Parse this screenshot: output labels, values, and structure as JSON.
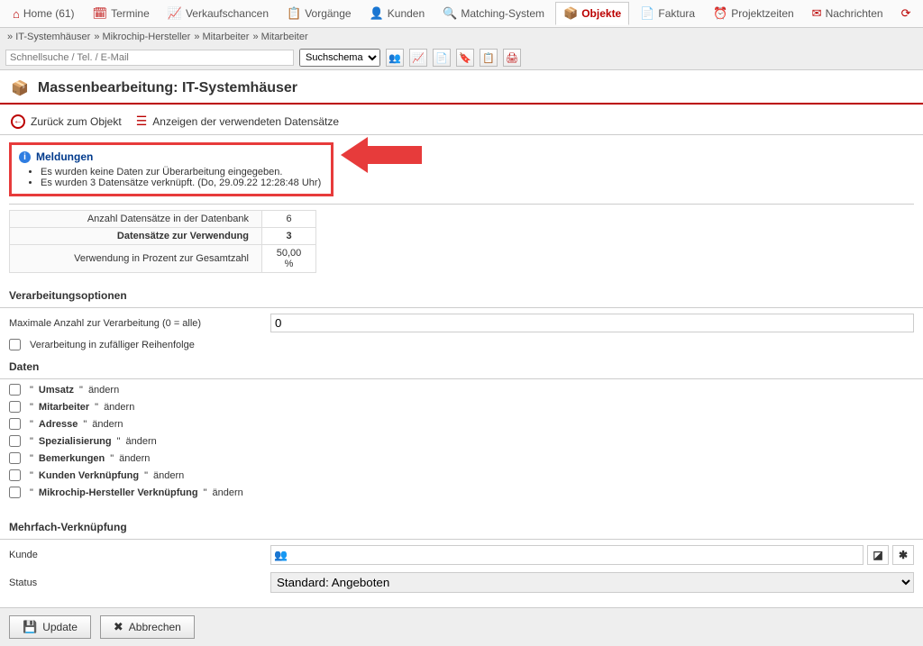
{
  "topnav": [
    {
      "label": "Home (61)",
      "icon": "⌂"
    },
    {
      "label": "Termine",
      "icon": "🗓"
    },
    {
      "label": "Verkaufschancen",
      "icon": "📈"
    },
    {
      "label": "Vorgänge",
      "icon": "📋"
    },
    {
      "label": "Kunden",
      "icon": "👤"
    },
    {
      "label": "Matching-System",
      "icon": "🔍"
    },
    {
      "label": "Objekte",
      "icon": "📦"
    },
    {
      "label": "Faktura",
      "icon": "📄"
    },
    {
      "label": "Projektzeiten",
      "icon": "⏰"
    },
    {
      "label": "Nachrichten",
      "icon": "✉"
    }
  ],
  "topnav_active_index": 6,
  "breadcrumb": [
    "IT-Systemhäuser",
    "Mikrochip-Hersteller",
    "Mitarbeiter",
    "Mitarbeiter"
  ],
  "search": {
    "placeholder": "Schnellsuche / Tel. / E-Mail",
    "schema_label": "Suchschema"
  },
  "page_title": "Massenbearbeitung: IT-Systemhäuser",
  "actionbar": {
    "back": "Zurück zum Objekt",
    "show": "Anzeigen der verwendeten Datensätze"
  },
  "meldungen": {
    "title": "Meldungen",
    "items": [
      "Es wurden keine Daten zur Überarbeitung eingegeben.",
      "Es wurden 3 Datensätze verknüpft. (Do, 29.09.22 12:28:48 Uhr)"
    ]
  },
  "stats": {
    "rows": [
      {
        "label": "Anzahl Datensätze in der Datenbank",
        "value": "6"
      },
      {
        "label": "Datensätze zur Verwendung",
        "value": "3",
        "bold": true
      },
      {
        "label": "Verwendung in Prozent zur Gesamtzahl",
        "value": "50,00 %"
      }
    ]
  },
  "verarbeitung": {
    "header": "Verarbeitungsoptionen",
    "max_label": "Maximale Anzahl zur Verarbeitung (0 = alle)",
    "max_value": "0",
    "random_label": "Verarbeitung in zufälliger Reihenfolge"
  },
  "daten": {
    "header": "Daten",
    "items": [
      {
        "field": "Umsatz",
        "suffix": " ändern"
      },
      {
        "field": "Mitarbeiter",
        "suffix": " ändern"
      },
      {
        "field": "Adresse",
        "suffix": " ändern"
      },
      {
        "field": "Spezialisierung",
        "suffix": " ändern"
      },
      {
        "field": "Bemerkungen",
        "suffix": " ändern"
      },
      {
        "field": "Kunden Verknüpfung",
        "suffix": " ändern"
      },
      {
        "field": "Mikrochip-Hersteller Verknüpfung",
        "suffix": " ändern"
      }
    ]
  },
  "mehrfach": {
    "header": "Mehrfach-Verknüpfung",
    "kunde_label": "Kunde",
    "kunde_icon": "👥",
    "status_label": "Status",
    "status_value": "Standard: Angeboten"
  },
  "footer": {
    "update": "Update",
    "cancel": "Abbrechen"
  }
}
